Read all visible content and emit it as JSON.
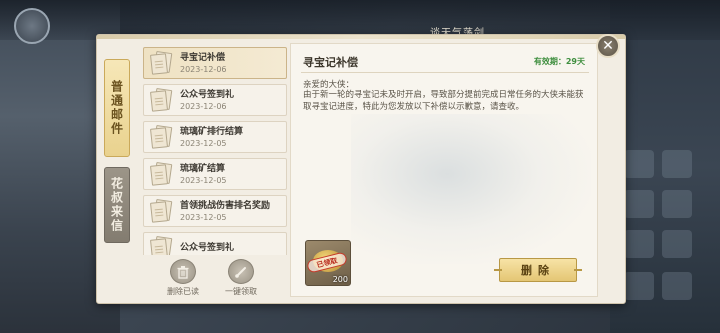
{
  "top_bar": {
    "text": "谈天气荡剑"
  },
  "tabs": [
    {
      "label": "普通邮件",
      "active": true
    },
    {
      "label": "花叔来信",
      "active": false
    }
  ],
  "mails": [
    {
      "title": "寻宝记补偿",
      "date": "2023-12-06",
      "selected": true
    },
    {
      "title": "公众号签到礼",
      "date": "2023-12-06",
      "selected": false
    },
    {
      "title": "琉璃矿排行结算",
      "date": "2023-12-05",
      "selected": false
    },
    {
      "title": "琉璃矿结算",
      "date": "2023-12-05",
      "selected": false
    },
    {
      "title": "首领挑战伤害排名奖励",
      "date": "2023-12-05",
      "selected": false
    },
    {
      "title": "公众号签到礼",
      "date": "",
      "selected": false
    }
  ],
  "actions": {
    "delete_read": "删除已读",
    "claim_all": "一键领取"
  },
  "detail": {
    "title": "寻宝记补偿",
    "expiry": "有效期：29天",
    "greeting": "亲爱的大侠：",
    "body": "由于新一轮的寻宝记未及时开启，导致部分提前完成日常任务的大侠未能获取寻宝记进度，特此为您发放以下补偿以示歉意，请查收。",
    "reward": {
      "stamp": "已领取",
      "count": "200"
    },
    "delete_label": "删除"
  },
  "colors": {
    "accent_gold": "#e4c674",
    "expiry_green": "#3e8e3e"
  }
}
